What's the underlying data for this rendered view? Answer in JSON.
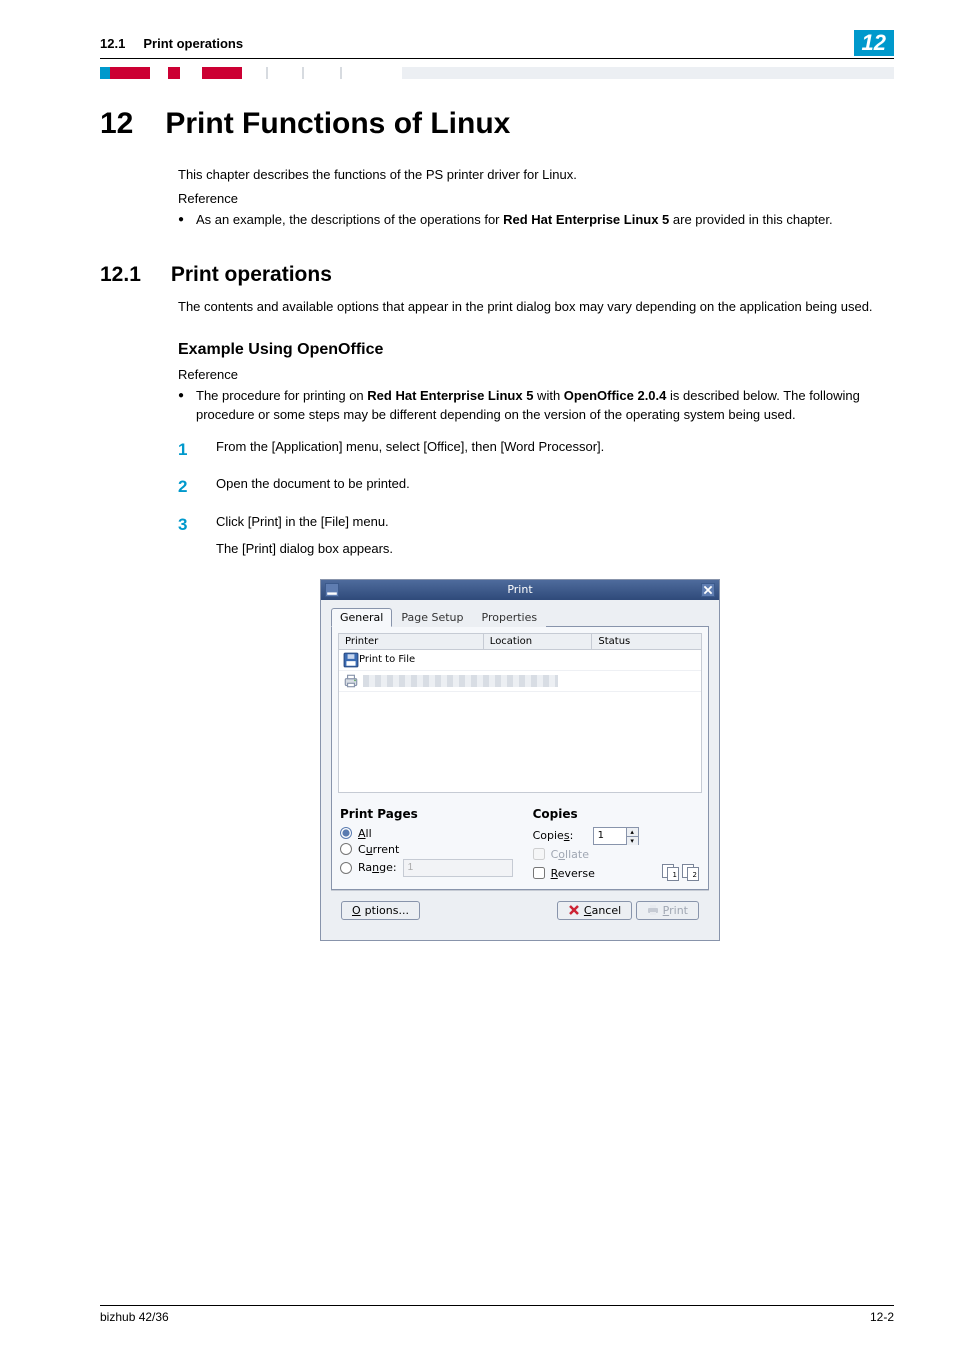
{
  "header": {
    "section_num": "12.1",
    "section_title": "Print operations",
    "chapter_badge": "12"
  },
  "h1": {
    "num": "12",
    "text": "Print Functions of Linux"
  },
  "intro": {
    "p1": "This chapter describes the functions of the PS printer driver for Linux.",
    "ref_label": "Reference",
    "bullet1_pre": "As an example, the descriptions of the operations for ",
    "bullet1_bold": "Red Hat Enterprise Linux 5",
    "bullet1_post": " are provided in this chapter."
  },
  "h2": {
    "num": "12.1",
    "text": "Print operations"
  },
  "sec_para": "The contents and available options that appear in the print dialog box may vary depending on the application being used.",
  "h3": "Example Using OpenOffice",
  "h3_ref_label": "Reference",
  "h3_bullet": {
    "pre": "The procedure for printing on ",
    "b1": "Red Hat Enterprise Linux 5",
    "mid": " with ",
    "b2": "OpenOffice 2.0.4",
    "post": " is described below. The following procedure or some steps may be different depending on the version of the operating system being used."
  },
  "steps": {
    "s1_num": "1",
    "s1": "From the [Application] menu, select [Office], then [Word Processor].",
    "s2_num": "2",
    "s2": "Open the document to be printed.",
    "s3_num": "3",
    "s3": "Click [Print] in the [File] menu.",
    "s3_sub": "The [Print] dialog box appears."
  },
  "dialog": {
    "title": "Print",
    "tabs": {
      "general": "General",
      "page_setup": "Page Setup",
      "properties": "Properties"
    },
    "cols": {
      "printer": "Printer",
      "location": "Location",
      "status": "Status"
    },
    "rows": {
      "print_to_file": "Print to File"
    },
    "print_pages": {
      "title": "Print Pages",
      "all": "All",
      "current": "Current",
      "range_label": "Range:",
      "range_value": "1"
    },
    "copies": {
      "title": "Copies",
      "label": "Copies:",
      "value": "1",
      "collate": "Collate",
      "reverse": "Reverse"
    },
    "buttons": {
      "options": "Options...",
      "cancel": "Cancel",
      "print": "Print"
    }
  },
  "footer": {
    "left": "bizhub 42/36",
    "right": "12-2"
  }
}
